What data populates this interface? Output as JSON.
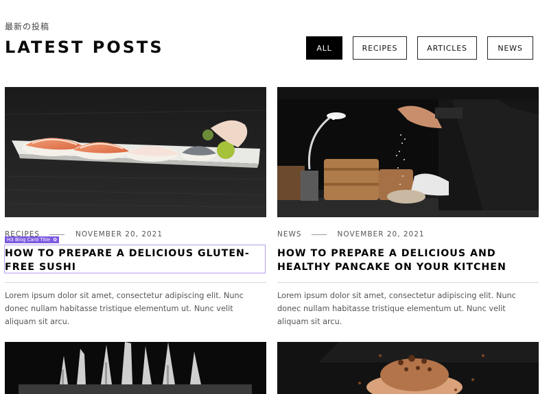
{
  "header": {
    "subtitle": "最新の投稿",
    "title": "LATEST POSTS"
  },
  "filters": [
    {
      "label": "ALL",
      "active": true
    },
    {
      "label": "RECIPES",
      "active": false
    },
    {
      "label": "ARTICLES",
      "active": false
    },
    {
      "label": "NEWS",
      "active": false
    }
  ],
  "editor": {
    "tag_label": "H3 Blog Card Title",
    "accent_color": "#7c5ae0"
  },
  "posts": [
    {
      "category": "RECIPES",
      "date": "NOVEMBER 20, 2021",
      "title": "HOW TO PREPARE A DELICIOUS GLUTEN-FREE SUSHI",
      "excerpt": "Lorem ipsum dolor sit amet, consectetur adipiscing elit. Nunc donec nullam habitasse tristique elementum ut. Nunc velit aliquam sit arcu.",
      "image": "sushi-platter-photo"
    },
    {
      "category": "NEWS",
      "date": "NOVEMBER 20, 2021",
      "title": "HOW TO PREPARE A DELICIOUS AND HEALTHY PANCAKE ON YOUR KITCHEN",
      "excerpt": "Lorem ipsum dolor sit amet, consectetur adipiscing elit. Nunc donec nullam habitasse tristique elementum ut. Nunc velit aliquam sit arcu.",
      "image": "chef-seasoning-photo"
    },
    {
      "image": "knives-photo"
    },
    {
      "image": "chocolate-dessert-photo"
    }
  ]
}
